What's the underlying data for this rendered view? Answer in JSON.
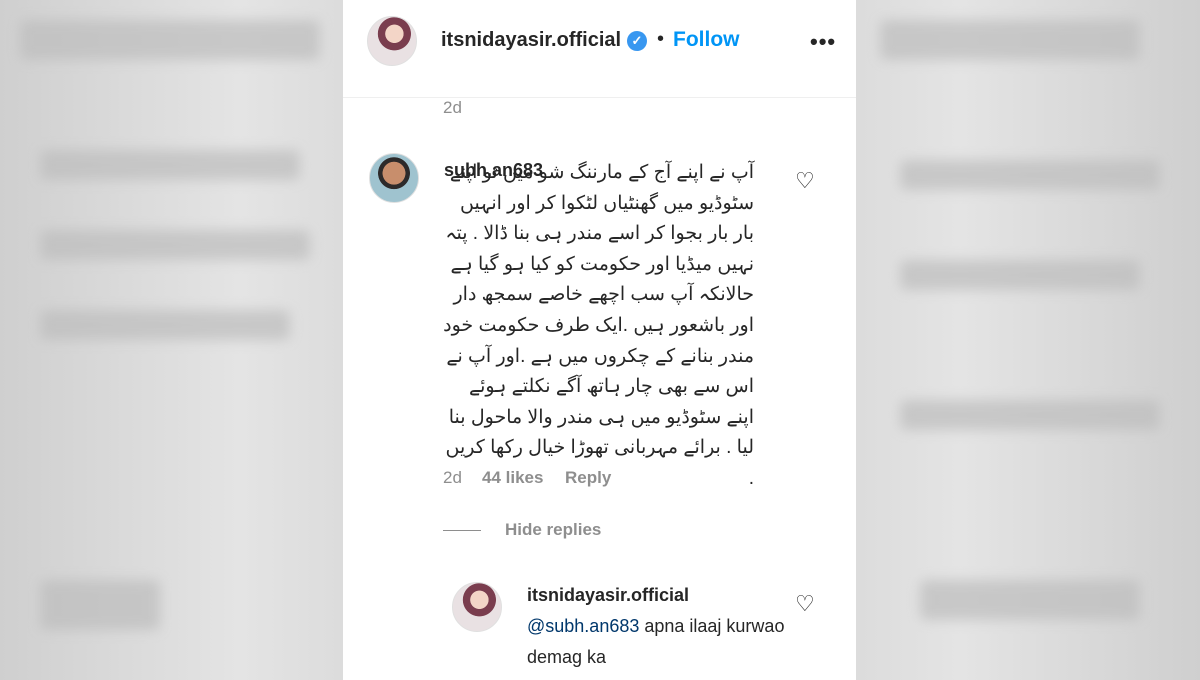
{
  "header": {
    "username": "itsnidayasir.official",
    "verified_icon": "verified-badge-icon",
    "separator": "•",
    "follow_label": "Follow",
    "more_label": "•••"
  },
  "top_meta": {
    "time": "2d"
  },
  "comment": {
    "username": "subh.an683",
    "text": "آپ نے اپنے آج کے مارننگ شو میں تو اپنے سٹوڈیو میں گھنٹیاں لٹکوا کر اور انہیں بار بار بجوا کر اسے مندر ہی بنا ڈالا . پتہ نہیں میڈیا اور حکومت کو کیا ہو گیا ہے حالانکہ آپ سب اچھے خاصے سمجھ دار اور باشعور ہیں .ایک طرف حکومت خود مندر بنانے کے چکروں میں ہے .اور آپ نے اس سے بھی چار ہاتھ آگے نکلتے ہوئے اپنے سٹوڈیو میں ہی مندر والا ماحول بنا لیا . برائے مہربانی تھوڑا خیال رکھا کریں .",
    "time": "2d",
    "likes": "44 likes",
    "reply_label": "Reply",
    "hide_replies_label": "Hide replies"
  },
  "reply": {
    "username": "itsnidayasir.official",
    "mention": "@subh.an683",
    "text": " apna ilaaj kurwao demag ka"
  },
  "colors": {
    "accent": "#0095f6",
    "muted": "#8e8e8e",
    "text": "#262626",
    "mention": "#00376b"
  }
}
